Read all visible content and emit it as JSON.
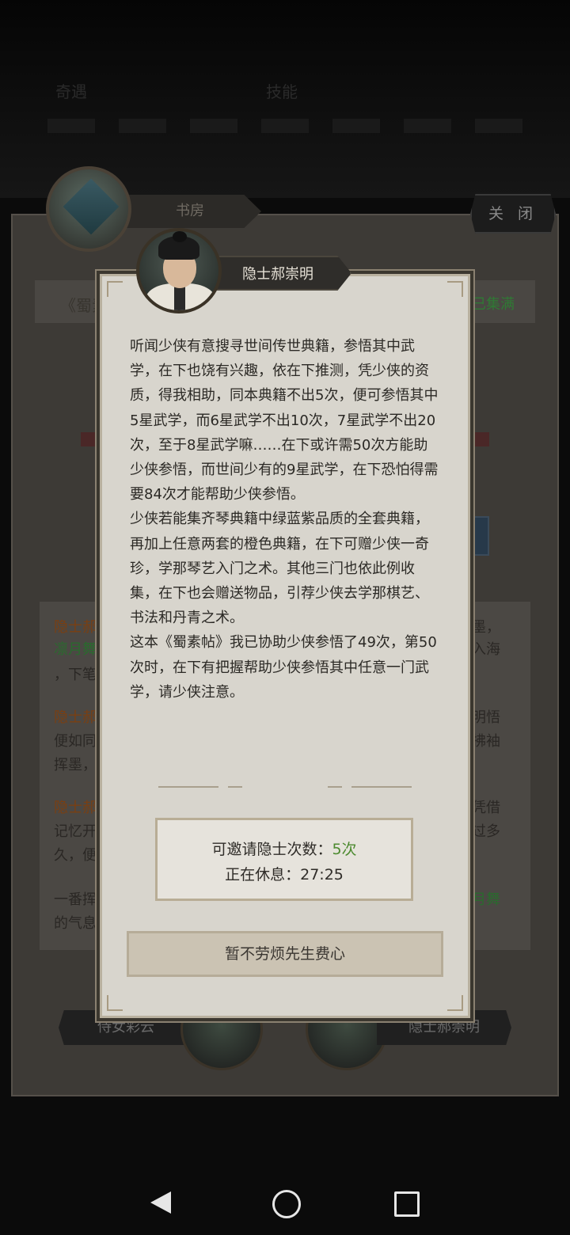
{
  "background": {
    "top_title_left": "奇遇",
    "top_title_right": "技能",
    "study_tab": "书房",
    "close_label": "关 闭",
    "book_title_fragment": "《蜀素",
    "collected_status": "已集满",
    "log_lines": [
      {
        "text": "隐士郝",
        "color": "orange"
      },
      {
        "text": "凛月舞",
        "color": "green"
      },
      {
        "text": "，下笔",
        "color": "normal"
      },
      {
        "text": "隐士郝",
        "color": "orange"
      },
      {
        "text": "便如同",
        "color": "normal"
      },
      {
        "text": "挥墨，",
        "color": "normal"
      },
      {
        "text": "隐士郝",
        "color": "orange"
      },
      {
        "text": "记忆开",
        "color": "normal"
      },
      {
        "text": "久，便",
        "color": "normal"
      },
      {
        "text": "一番挥",
        "color": "normal"
      },
      {
        "text": "的气息",
        "color": "normal"
      }
    ],
    "log_right": [
      {
        "text": "墨，",
        "color": "normal"
      },
      {
        "text": "入海",
        "color": "normal"
      },
      {
        "text": "明悟",
        "color": "normal"
      },
      {
        "text": "拂袖",
        "color": "normal"
      },
      {
        "text": "凭借",
        "color": "normal"
      },
      {
        "text": "过多",
        "color": "normal"
      },
      {
        "text": "月舞",
        "color": "green"
      }
    ],
    "companion_left": "侍女彩云",
    "companion_right": "隐士郝崇明"
  },
  "dialog": {
    "speaker": "隐士郝崇明",
    "story": "听闻少侠有意搜寻世间传世典籍，参悟其中武学，在下也饶有兴趣，依在下推测，凭少侠的资质，得我相助，同本典籍不出5次，便可参悟其中5星武学，而6星武学不出10次，7星武学不出20次，至于8星武学嘛……在下或许需50次方能助少侠参悟，而世间少有的9星武学，在下恐怕得需要84次才能帮助少侠参悟。\n少侠若能集齐琴典籍中绿蓝紫品质的全套典籍，再加上任意两套的橙色典籍，在下可赠少侠一奇珍，学那琴艺入门之术。其他三门也依此例收集，在下也会赠送物品，引荐少侠去学那棋艺、书法和丹青之术。\n这本《蜀素帖》我已协助少侠参悟了49次，第50次时，在下有把握帮助少侠参悟其中任意一门武学，请少侠注意。",
    "invite_label": "可邀请隐士次数：",
    "invite_value": "5次",
    "rest_label": "正在休息：",
    "rest_time": "27:25",
    "decline_button": "暂不劳烦先生费心"
  },
  "colors": {
    "accent_green": "#4c8a2f",
    "panel_bg": "#d8d5cd",
    "dark_tab": "#2f2d2a"
  },
  "icons": [
    "back-icon",
    "home-icon",
    "recent-apps-icon"
  ]
}
